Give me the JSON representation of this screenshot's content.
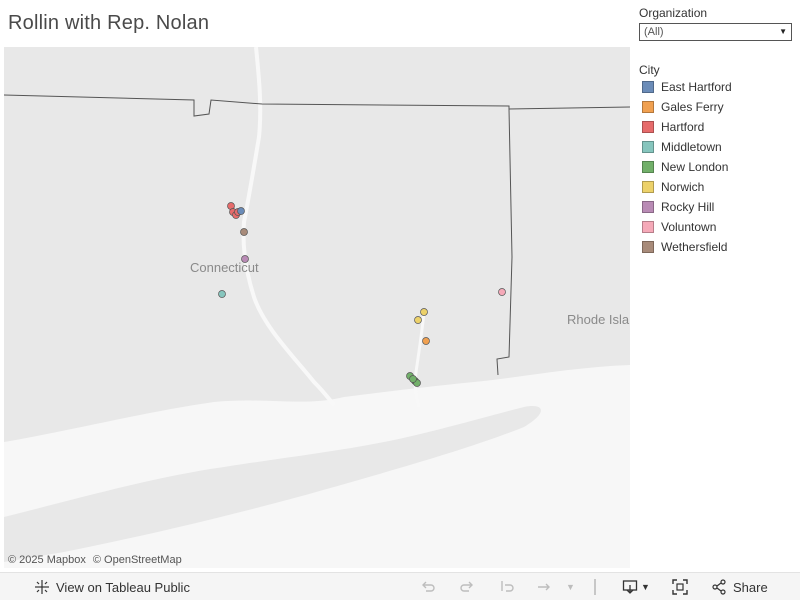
{
  "title": "Rollin with Rep. Nolan",
  "filter": {
    "label": "Organization",
    "selected": "(All)",
    "icon": "chevron-down-icon"
  },
  "legend": {
    "title": "City",
    "items": [
      {
        "name": "East Hartford",
        "color": "#6b8cb8"
      },
      {
        "name": "Gales Ferry",
        "color": "#f0a050"
      },
      {
        "name": "Hartford",
        "color": "#e66b6b"
      },
      {
        "name": "Middletown",
        "color": "#86c5bd"
      },
      {
        "name": "New London",
        "color": "#72b06a"
      },
      {
        "name": "Norwich",
        "color": "#ecd16a"
      },
      {
        "name": "Rocky Hill",
        "color": "#b98bb5"
      },
      {
        "name": "Voluntown",
        "color": "#f5a9b8"
      },
      {
        "name": "Wethersfield",
        "color": "#a88b7a"
      }
    ]
  },
  "map": {
    "labels": {
      "state1": "Connecticut",
      "state2": "Rhode Isla"
    },
    "attribution": {
      "mapbox": "© 2025 Mapbox",
      "osm": "© OpenStreetMap"
    }
  },
  "toolbar": {
    "view_label": "View on Tableau Public",
    "share_label": "Share",
    "icons": [
      "tableau-icon",
      "undo-icon",
      "redo-icon",
      "revert-icon",
      "refresh-icon",
      "pause-icon",
      "download-icon",
      "fullscreen-icon",
      "share-icon"
    ]
  }
}
